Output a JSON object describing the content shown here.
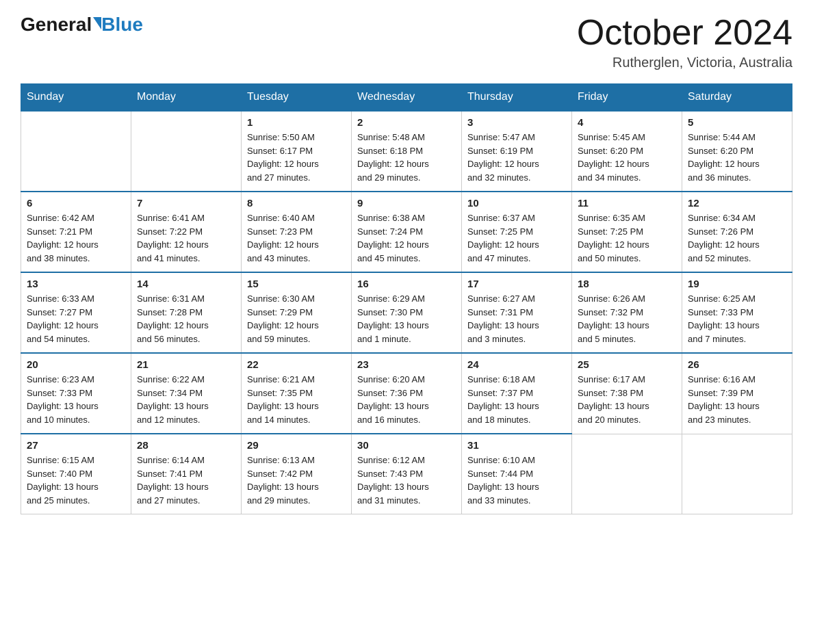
{
  "header": {
    "logo_general": "General",
    "logo_blue": "Blue",
    "title": "October 2024",
    "subtitle": "Rutherglen, Victoria, Australia"
  },
  "days_of_week": [
    "Sunday",
    "Monday",
    "Tuesday",
    "Wednesday",
    "Thursday",
    "Friday",
    "Saturday"
  ],
  "weeks": [
    [
      {
        "day": "",
        "info": ""
      },
      {
        "day": "",
        "info": ""
      },
      {
        "day": "1",
        "info": "Sunrise: 5:50 AM\nSunset: 6:17 PM\nDaylight: 12 hours\nand 27 minutes."
      },
      {
        "day": "2",
        "info": "Sunrise: 5:48 AM\nSunset: 6:18 PM\nDaylight: 12 hours\nand 29 minutes."
      },
      {
        "day": "3",
        "info": "Sunrise: 5:47 AM\nSunset: 6:19 PM\nDaylight: 12 hours\nand 32 minutes."
      },
      {
        "day": "4",
        "info": "Sunrise: 5:45 AM\nSunset: 6:20 PM\nDaylight: 12 hours\nand 34 minutes."
      },
      {
        "day": "5",
        "info": "Sunrise: 5:44 AM\nSunset: 6:20 PM\nDaylight: 12 hours\nand 36 minutes."
      }
    ],
    [
      {
        "day": "6",
        "info": "Sunrise: 6:42 AM\nSunset: 7:21 PM\nDaylight: 12 hours\nand 38 minutes."
      },
      {
        "day": "7",
        "info": "Sunrise: 6:41 AM\nSunset: 7:22 PM\nDaylight: 12 hours\nand 41 minutes."
      },
      {
        "day": "8",
        "info": "Sunrise: 6:40 AM\nSunset: 7:23 PM\nDaylight: 12 hours\nand 43 minutes."
      },
      {
        "day": "9",
        "info": "Sunrise: 6:38 AM\nSunset: 7:24 PM\nDaylight: 12 hours\nand 45 minutes."
      },
      {
        "day": "10",
        "info": "Sunrise: 6:37 AM\nSunset: 7:25 PM\nDaylight: 12 hours\nand 47 minutes."
      },
      {
        "day": "11",
        "info": "Sunrise: 6:35 AM\nSunset: 7:25 PM\nDaylight: 12 hours\nand 50 minutes."
      },
      {
        "day": "12",
        "info": "Sunrise: 6:34 AM\nSunset: 7:26 PM\nDaylight: 12 hours\nand 52 minutes."
      }
    ],
    [
      {
        "day": "13",
        "info": "Sunrise: 6:33 AM\nSunset: 7:27 PM\nDaylight: 12 hours\nand 54 minutes."
      },
      {
        "day": "14",
        "info": "Sunrise: 6:31 AM\nSunset: 7:28 PM\nDaylight: 12 hours\nand 56 minutes."
      },
      {
        "day": "15",
        "info": "Sunrise: 6:30 AM\nSunset: 7:29 PM\nDaylight: 12 hours\nand 59 minutes."
      },
      {
        "day": "16",
        "info": "Sunrise: 6:29 AM\nSunset: 7:30 PM\nDaylight: 13 hours\nand 1 minute."
      },
      {
        "day": "17",
        "info": "Sunrise: 6:27 AM\nSunset: 7:31 PM\nDaylight: 13 hours\nand 3 minutes."
      },
      {
        "day": "18",
        "info": "Sunrise: 6:26 AM\nSunset: 7:32 PM\nDaylight: 13 hours\nand 5 minutes."
      },
      {
        "day": "19",
        "info": "Sunrise: 6:25 AM\nSunset: 7:33 PM\nDaylight: 13 hours\nand 7 minutes."
      }
    ],
    [
      {
        "day": "20",
        "info": "Sunrise: 6:23 AM\nSunset: 7:33 PM\nDaylight: 13 hours\nand 10 minutes."
      },
      {
        "day": "21",
        "info": "Sunrise: 6:22 AM\nSunset: 7:34 PM\nDaylight: 13 hours\nand 12 minutes."
      },
      {
        "day": "22",
        "info": "Sunrise: 6:21 AM\nSunset: 7:35 PM\nDaylight: 13 hours\nand 14 minutes."
      },
      {
        "day": "23",
        "info": "Sunrise: 6:20 AM\nSunset: 7:36 PM\nDaylight: 13 hours\nand 16 minutes."
      },
      {
        "day": "24",
        "info": "Sunrise: 6:18 AM\nSunset: 7:37 PM\nDaylight: 13 hours\nand 18 minutes."
      },
      {
        "day": "25",
        "info": "Sunrise: 6:17 AM\nSunset: 7:38 PM\nDaylight: 13 hours\nand 20 minutes."
      },
      {
        "day": "26",
        "info": "Sunrise: 6:16 AM\nSunset: 7:39 PM\nDaylight: 13 hours\nand 23 minutes."
      }
    ],
    [
      {
        "day": "27",
        "info": "Sunrise: 6:15 AM\nSunset: 7:40 PM\nDaylight: 13 hours\nand 25 minutes."
      },
      {
        "day": "28",
        "info": "Sunrise: 6:14 AM\nSunset: 7:41 PM\nDaylight: 13 hours\nand 27 minutes."
      },
      {
        "day": "29",
        "info": "Sunrise: 6:13 AM\nSunset: 7:42 PM\nDaylight: 13 hours\nand 29 minutes."
      },
      {
        "day": "30",
        "info": "Sunrise: 6:12 AM\nSunset: 7:43 PM\nDaylight: 13 hours\nand 31 minutes."
      },
      {
        "day": "31",
        "info": "Sunrise: 6:10 AM\nSunset: 7:44 PM\nDaylight: 13 hours\nand 33 minutes."
      },
      {
        "day": "",
        "info": ""
      },
      {
        "day": "",
        "info": ""
      }
    ]
  ]
}
